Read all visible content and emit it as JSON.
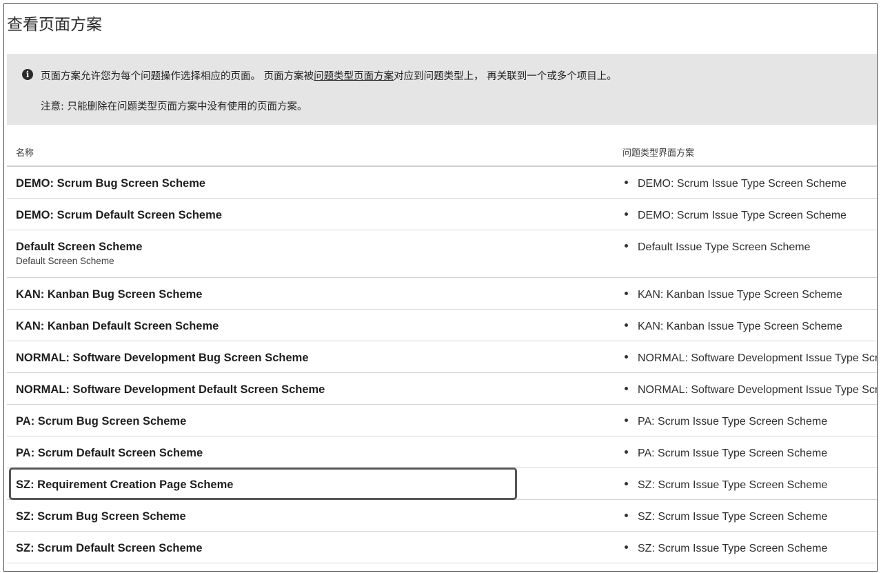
{
  "page": {
    "title": "查看页面方案"
  },
  "info": {
    "icon": "info-icon",
    "line1_before": "页面方案允许您为每个问题操作选择相应的页面。 页面方案被",
    "line1_link": "问题类型页面方案",
    "line1_after": "对应到问题类型上， 再关联到一个或多个项目上。",
    "line2": "注意: 只能删除在问题类型页面方案中没有使用的页面方案。"
  },
  "table": {
    "headers": {
      "name": "名称",
      "scheme": "问题类型界面方案"
    },
    "rows": [
      {
        "name": "DEMO: Scrum Bug Screen Scheme",
        "description": "",
        "scheme": "DEMO: Scrum Issue Type Screen Scheme"
      },
      {
        "name": "DEMO: Scrum Default Screen Scheme",
        "description": "",
        "scheme": "DEMO: Scrum Issue Type Screen Scheme"
      },
      {
        "name": "Default Screen Scheme",
        "description": "Default Screen Scheme",
        "scheme": "Default Issue Type Screen Scheme"
      },
      {
        "name": "KAN: Kanban Bug Screen Scheme",
        "description": "",
        "scheme": "KAN: Kanban Issue Type Screen Scheme"
      },
      {
        "name": "KAN: Kanban Default Screen Scheme",
        "description": "",
        "scheme": "KAN: Kanban Issue Type Screen Scheme"
      },
      {
        "name": "NORMAL: Software Development Bug Screen Scheme",
        "description": "",
        "scheme": "NORMAL: Software Development Issue Type Screen Scheme"
      },
      {
        "name": "NORMAL: Software Development Default Screen Scheme",
        "description": "",
        "scheme": "NORMAL: Software Development Issue Type Screen Scheme"
      },
      {
        "name": "PA: Scrum Bug Screen Scheme",
        "description": "",
        "scheme": "PA: Scrum Issue Type Screen Scheme"
      },
      {
        "name": "PA: Scrum Default Screen Scheme",
        "description": "",
        "scheme": "PA: Scrum Issue Type Screen Scheme"
      },
      {
        "name": "SZ: Requirement Creation Page Scheme",
        "description": "",
        "scheme": "SZ: Scrum Issue Type Screen Scheme"
      },
      {
        "name": "SZ: Scrum Bug Screen Scheme",
        "description": "",
        "scheme": "SZ: Scrum Issue Type Screen Scheme"
      },
      {
        "name": "SZ: Scrum Default Screen Scheme",
        "description": "",
        "scheme": "SZ: Scrum Issue Type Screen Scheme"
      }
    ]
  }
}
